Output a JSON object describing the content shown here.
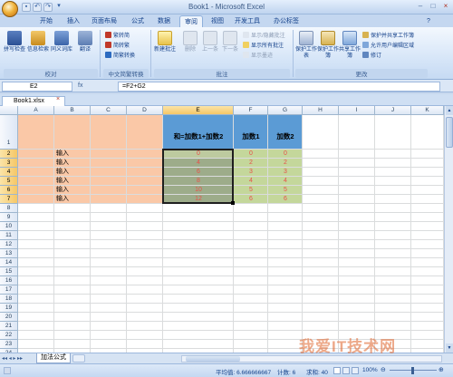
{
  "window": {
    "title": "Book1 - Microsoft Excel",
    "controls": [
      "–",
      "□",
      "×"
    ]
  },
  "ribbon_tabs": [
    "开始",
    "插入",
    "页面布局",
    "公式",
    "数据",
    "审阅",
    "视图",
    "开发工具",
    "办公标签"
  ],
  "active_tab": "审阅",
  "ribbon": {
    "proofing": {
      "label": "校对",
      "buttons": [
        "拼写检查",
        "信息检索",
        "同义词库",
        "翻译"
      ]
    },
    "chinese": {
      "label": "中文简繁转换",
      "buttons": [
        "繁转简",
        "简转繁",
        "简繁转换"
      ]
    },
    "comments": {
      "label": "批注",
      "big_buttons": [
        "新建批注",
        "删除",
        "上一条",
        "下一条"
      ],
      "small_buttons": [
        "显示/隐藏批注",
        "显示所有批注",
        "显示墨迹"
      ]
    },
    "changes": {
      "label": "更改",
      "big_buttons": [
        "保护工作表",
        "保护工作簿",
        "共享工作簿"
      ],
      "small_buttons": [
        "保护并共享工作簿",
        "允许用户编辑区域",
        "修订"
      ]
    }
  },
  "formula_bar": {
    "name_box": "E2",
    "fx": "fx",
    "formula": "=F2+G2"
  },
  "doc_tab": "Book1.xlsx",
  "columns": [
    "A",
    "B",
    "C",
    "D",
    "E",
    "F",
    "G",
    "H",
    "I",
    "J",
    "K"
  ],
  "rows": [
    "1",
    "2",
    "3",
    "4",
    "5",
    "6",
    "7",
    "8",
    "9",
    "10",
    "11",
    "12",
    "13",
    "14",
    "15",
    "16",
    "17",
    "18",
    "19",
    "20",
    "21",
    "22",
    "23",
    "24",
    "25"
  ],
  "selected_column": "E",
  "headers_row1": {
    "E": "和=加数1+加数2",
    "F": "加数1",
    "G": "加数2"
  },
  "input_label": "输入",
  "table_rows": [
    {
      "e": "0",
      "f": "0",
      "g": "0"
    },
    {
      "e": "4",
      "f": "2",
      "g": "2"
    },
    {
      "e": "6",
      "f": "3",
      "g": "3"
    },
    {
      "e": "8",
      "f": "4",
      "g": "4"
    },
    {
      "e": "10",
      "f": "5",
      "g": "5"
    },
    {
      "e": "12",
      "f": "6",
      "g": "6"
    }
  ],
  "sheet_tab": "加法公式",
  "status": {
    "average": "平均值: 6.666666667",
    "count": "计数: 6",
    "sum": "求和: 40",
    "zoom": "100%"
  },
  "watermark": "我爱IT技术网",
  "colors": {
    "header_blue": "#5b9bd5",
    "label_orange": "#fac8a7",
    "result_green": "#9dac8a",
    "addend_green": "#c4d79b",
    "value_red": "#e8514b"
  }
}
